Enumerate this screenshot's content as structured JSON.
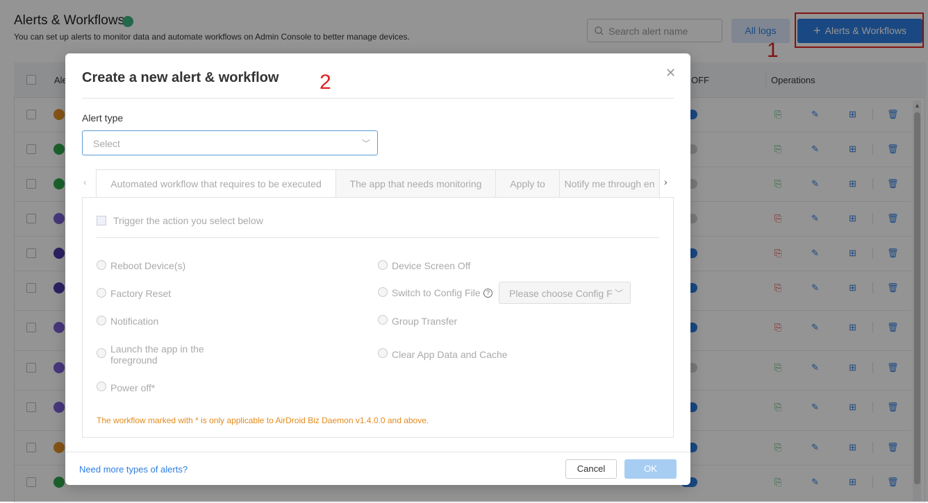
{
  "header": {
    "title": "Alerts & Workflows",
    "subtitle": "You can set up alerts to monitor data and automate workflows on Admin Console to better manage devices.",
    "search_placeholder": "Search alert name",
    "all_logs_label": "All logs",
    "add_button_label": "Alerts & Workflows"
  },
  "annotations": {
    "step1": "1",
    "step2": "2"
  },
  "table": {
    "col_name": "Ale",
    "col_onoff": "OFF",
    "col_operations": "Operations",
    "row_icon_colors": [
      "#e5922a",
      "#2fa84f",
      "#2fa84f",
      "#7b5fd6",
      "#4b3aa8",
      "#4b3aa8",
      "#7b5fd6",
      "#7b5fd6",
      "#7b5fd6",
      "#e5922a",
      "#2fa84f"
    ],
    "row_toggle_on": [
      true,
      false,
      false,
      false,
      true,
      true,
      true,
      false,
      true,
      true,
      true
    ],
    "row_view_icon_colors": [
      "#2fa84f",
      "#2fa84f",
      "#2fa84f",
      "#e02020",
      "#e02020",
      "#e02020",
      "#e02020",
      "#2fa84f",
      "#2fa84f",
      "#2fa84f",
      "#2fa84f"
    ]
  },
  "modal": {
    "title": "Create a new alert & workflow",
    "alert_type_label": "Alert type",
    "alert_type_placeholder": "Select",
    "tabs": [
      "Automated workflow that requires to be executed",
      "The app that needs monitoring",
      "Apply to",
      "Notify me through en"
    ],
    "trigger_label": "Trigger the action you select below",
    "actions_left": [
      "Reboot Device(s)",
      "Factory Reset",
      "Notification",
      "Launch the app in the",
      "foreground",
      "Power off*"
    ],
    "actions_right": [
      "Device Screen Off",
      "Switch to Config File",
      "Group Transfer",
      "Clear App Data and Cache"
    ],
    "config_placeholder": "Please choose Config File",
    "note": "The workflow marked with * is only applicable to AirDroid Biz Daemon v1.4.0.0 and above.",
    "more_alerts_link": "Need more types of alerts?",
    "cancel_label": "Cancel",
    "ok_label": "OK"
  }
}
